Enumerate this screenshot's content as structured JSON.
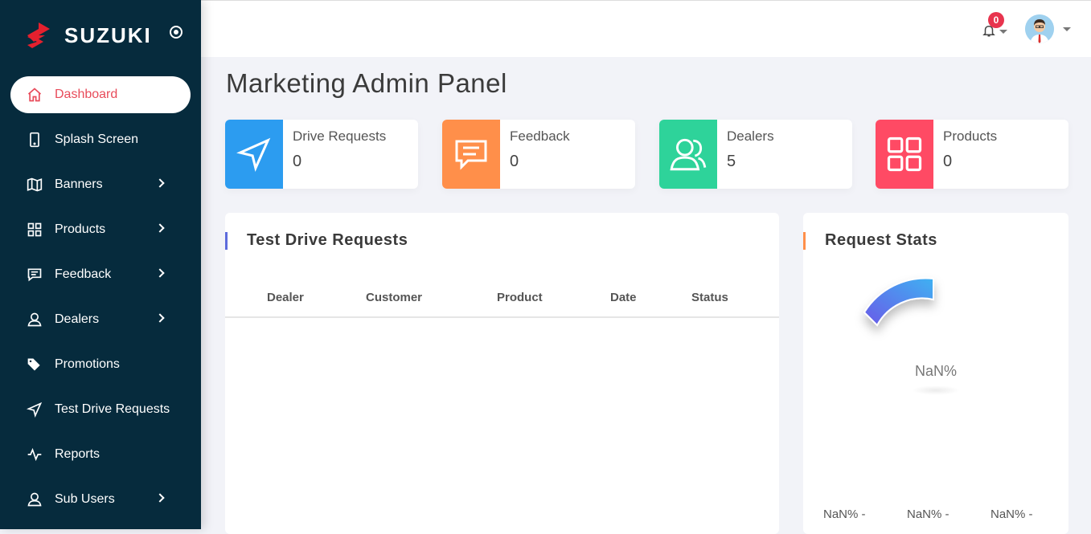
{
  "brand": {
    "name": "SUZUKI"
  },
  "sidebar": {
    "items": [
      {
        "label": "Dashboard",
        "icon": "home-icon",
        "active": true,
        "has_submenu": false
      },
      {
        "label": "Splash Screen",
        "icon": "tablet-icon",
        "active": false,
        "has_submenu": false
      },
      {
        "label": "Banners",
        "icon": "map-icon",
        "active": false,
        "has_submenu": true
      },
      {
        "label": "Products",
        "icon": "grid-icon",
        "active": false,
        "has_submenu": true
      },
      {
        "label": "Feedback",
        "icon": "message-icon",
        "active": false,
        "has_submenu": true
      },
      {
        "label": "Dealers",
        "icon": "user-icon",
        "active": false,
        "has_submenu": true
      },
      {
        "label": "Promotions",
        "icon": "tags-icon",
        "active": false,
        "has_submenu": false
      },
      {
        "label": "Test Drive Requests",
        "icon": "send-icon",
        "active": false,
        "has_submenu": false
      },
      {
        "label": "Reports",
        "icon": "activity-icon",
        "active": false,
        "has_submenu": false
      },
      {
        "label": "Sub Users",
        "icon": "user-icon",
        "active": false,
        "has_submenu": true
      }
    ]
  },
  "topbar": {
    "notification_count": "0"
  },
  "main": {
    "title": "Marketing Admin Panel",
    "stats": [
      {
        "label": "Drive Requests",
        "value": "0",
        "color": "#2c9cf0",
        "icon": "send-icon"
      },
      {
        "label": "Feedback",
        "value": "0",
        "color": "#ff8f4a",
        "icon": "message-icon"
      },
      {
        "label": "Dealers",
        "value": "5",
        "color": "#2ed39a",
        "icon": "users-icon"
      },
      {
        "label": "Products",
        "value": "0",
        "color": "#ff4a64",
        "icon": "grid-icon"
      }
    ],
    "test_drive": {
      "title": "Test Drive Requests",
      "columns": [
        "Dealer",
        "Customer",
        "Product",
        "Date",
        "Status"
      ],
      "rows": []
    },
    "request_stats": {
      "title": "Request Stats",
      "center_value": "NaN%",
      "legend": [
        "NaN% -",
        "NaN% -",
        "NaN% -"
      ]
    }
  },
  "colors": {
    "sidebar_bg": "#062b3d",
    "active_text": "#e84b5a",
    "accent_blue": "#5d6bdc",
    "accent_orange": "#ff8f4a"
  }
}
